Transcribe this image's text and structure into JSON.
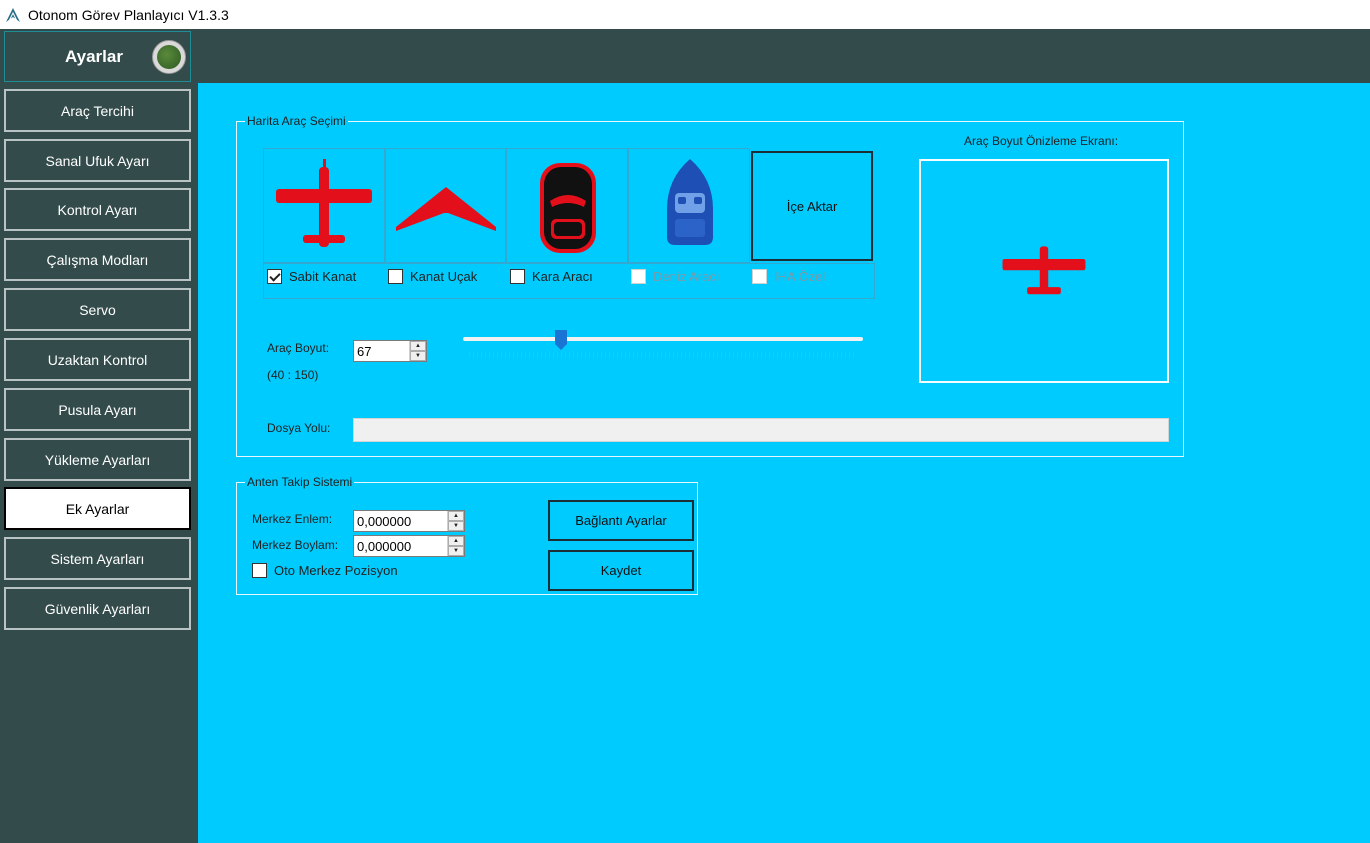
{
  "window": {
    "title": "Otonom Görev Planlayıcı V1.3.3"
  },
  "sidebar": {
    "header": "Ayarlar",
    "items": [
      {
        "label": "Araç Tercihi"
      },
      {
        "label": "Sanal Ufuk Ayarı"
      },
      {
        "label": "Kontrol Ayarı"
      },
      {
        "label": "Çalışma Modları"
      },
      {
        "label": "Servo"
      },
      {
        "label": "Uzaktan Kontrol"
      },
      {
        "label": "Pusula Ayarı"
      },
      {
        "label": "Yükleme Ayarları"
      },
      {
        "label": "Ek Ayarlar",
        "active": true
      },
      {
        "label": "Sistem Ayarları"
      },
      {
        "label": "Güvenlik Ayarları"
      }
    ]
  },
  "map_vehicle": {
    "group_title": "Harita Araç Seçimi",
    "vehicles": [
      {
        "label": "Sabit Kanat",
        "checked": true,
        "enabled": true,
        "icon": "fixed-wing-plane-icon"
      },
      {
        "label": "Kanat Uçak",
        "checked": false,
        "enabled": true,
        "icon": "flying-wing-icon"
      },
      {
        "label": "Kara Aracı",
        "checked": false,
        "enabled": true,
        "icon": "car-icon"
      },
      {
        "label": "Deniz Aracı",
        "checked": false,
        "enabled": false,
        "icon": "boat-icon"
      },
      {
        "label": "İHA Özel",
        "checked": false,
        "enabled": false,
        "icon": ""
      }
    ],
    "import_button": "İçe Aktar",
    "size_label": "Araç Boyut:",
    "size_value": "67",
    "size_range": "(40 : 150)",
    "size_min": 40,
    "size_max": 150,
    "path_label": "Dosya Yolu:",
    "path_value": "",
    "preview_title": "Araç Boyut Önizleme Ekranı:"
  },
  "antenna": {
    "group_title": "Anten Takip Sistemi",
    "lat_label": "Merkez Enlem:",
    "lat_value": "0,000000",
    "lon_label": "Merkez Boylam:",
    "lon_value": "0,000000",
    "auto_center_label": "Oto Merkez Pozisyon",
    "auto_center_checked": false,
    "connection_button": "Bağlantı Ayarlar",
    "save_button": "Kaydet"
  },
  "colors": {
    "main_bg": "#00cbff",
    "sidebar_bg": "#334b4b",
    "vehicle_red": "#e3101b",
    "boat_blue": "#1d4fb5"
  }
}
